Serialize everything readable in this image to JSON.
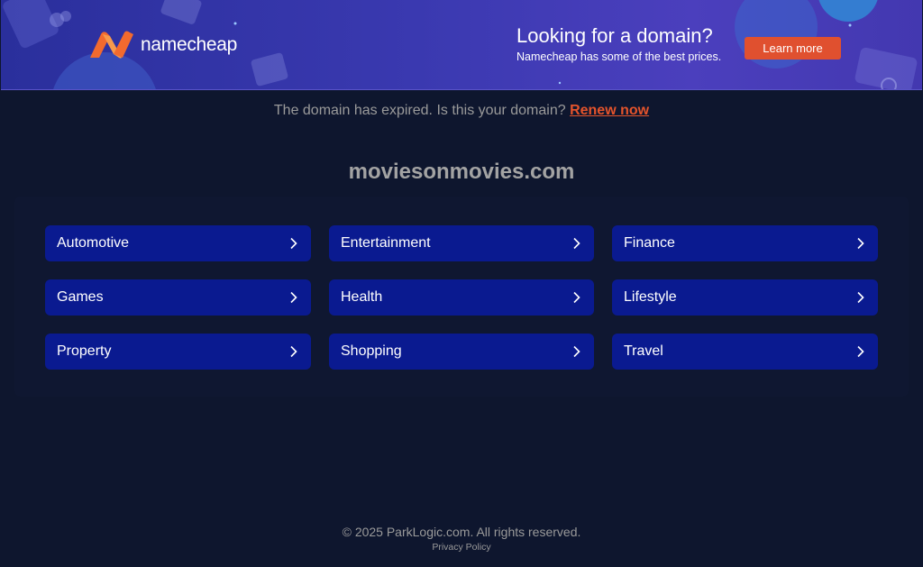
{
  "banner": {
    "logo_text": "namecheap",
    "promo_title": "Looking for a domain?",
    "promo_subtitle": "Namecheap has some of the best prices.",
    "cta_label": "Learn more",
    "accent_color": "#e0502f"
  },
  "notice": {
    "text": "The domain has expired. Is this your domain?",
    "link_label": "Renew now"
  },
  "domain": "moviesonmovies.com",
  "categories": [
    {
      "label": "Automotive",
      "icon": "chevron-right-icon"
    },
    {
      "label": "Entertainment",
      "icon": "chevron-right-icon"
    },
    {
      "label": "Finance",
      "icon": "chevron-right-icon"
    },
    {
      "label": "Games",
      "icon": "chevron-right-icon"
    },
    {
      "label": "Health",
      "icon": "chevron-right-icon"
    },
    {
      "label": "Lifestyle",
      "icon": "chevron-right-icon"
    },
    {
      "label": "Property",
      "icon": "chevron-right-icon"
    },
    {
      "label": "Shopping",
      "icon": "chevron-right-icon"
    },
    {
      "label": "Travel",
      "icon": "chevron-right-icon"
    }
  ],
  "footer": {
    "copyright": "© 2025 ParkLogic.com. All rights reserved.",
    "privacy_label": "Privacy Policy"
  }
}
